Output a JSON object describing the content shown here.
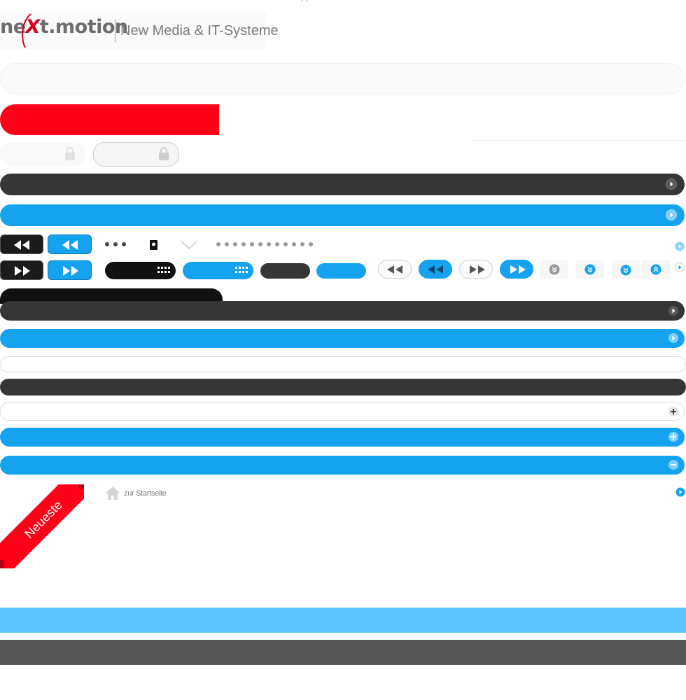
{
  "header": {
    "logo_prefix": "ne",
    "logo_x": "X",
    "logo_suffix": "t.motion",
    "tagline": "New Media & IT-Systeme",
    "brand_red": "#d4001d"
  },
  "colors": {
    "accent_blue": "#15a3ef",
    "dark_bar": "#363636",
    "red": "#ff0018",
    "light_blue_band": "#5cc5fb",
    "grey_band": "#575757"
  },
  "icons": {
    "rewind": "rewind-icon",
    "forward": "fast-forward-icon",
    "grid": "grid-icon",
    "lock": "lock-icon",
    "arrow_right": "arrow-right-icon",
    "plus": "plus-icon",
    "minus": "minus-icon",
    "home": "home-icon",
    "chevron_down": "chevron-down-icon",
    "chevron_up": "chevron-up-icon"
  },
  "navigation": {
    "home_link": "zur Startseite"
  },
  "ribbon": {
    "label": "Neueste"
  }
}
